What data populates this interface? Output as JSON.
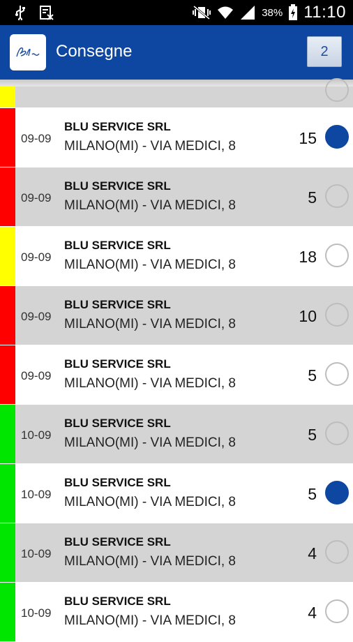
{
  "status_bar": {
    "battery_percent": "38%",
    "time": "11:10"
  },
  "action_bar": {
    "title": "Consegne",
    "count": "2"
  },
  "colors": {
    "red": "#ff0000",
    "yellow": "#ffff00",
    "green": "#00e600",
    "header_blue": "#0d47a1"
  },
  "deliveries": [
    {
      "date": "09-09",
      "company": "BLU SERVICE SRL",
      "address": "MILANO(MI) - VIA MEDICI, 8",
      "quantity": "15",
      "selected": true,
      "priority": "red",
      "bg": "white"
    },
    {
      "date": "09-09",
      "company": "BLU SERVICE SRL",
      "address": "MILANO(MI) - VIA MEDICI, 8",
      "quantity": "5",
      "selected": false,
      "priority": "red",
      "bg": "gray"
    },
    {
      "date": "09-09",
      "company": "BLU SERVICE SRL",
      "address": "MILANO(MI) - VIA MEDICI, 8",
      "quantity": "18",
      "selected": false,
      "priority": "yellow",
      "bg": "white"
    },
    {
      "date": "09-09",
      "company": "BLU SERVICE SRL",
      "address": "MILANO(MI) - VIA MEDICI, 8",
      "quantity": "10",
      "selected": false,
      "priority": "red",
      "bg": "gray"
    },
    {
      "date": "09-09",
      "company": "BLU SERVICE SRL",
      "address": "MILANO(MI) - VIA MEDICI, 8",
      "quantity": "5",
      "selected": false,
      "priority": "red",
      "bg": "white"
    },
    {
      "date": "10-09",
      "company": "BLU SERVICE SRL",
      "address": "MILANO(MI) - VIA MEDICI, 8",
      "quantity": "5",
      "selected": false,
      "priority": "green",
      "bg": "gray"
    },
    {
      "date": "10-09",
      "company": "BLU SERVICE SRL",
      "address": "MILANO(MI) - VIA MEDICI, 8",
      "quantity": "5",
      "selected": true,
      "priority": "green",
      "bg": "white"
    },
    {
      "date": "10-09",
      "company": "BLU SERVICE SRL",
      "address": "MILANO(MI) - VIA MEDICI, 8",
      "quantity": "4",
      "selected": false,
      "priority": "green",
      "bg": "gray"
    },
    {
      "date": "10-09",
      "company": "BLU SERVICE SRL",
      "address": "MILANO(MI) - VIA MEDICI, 8",
      "quantity": "4",
      "selected": false,
      "priority": "green",
      "bg": "white"
    }
  ]
}
